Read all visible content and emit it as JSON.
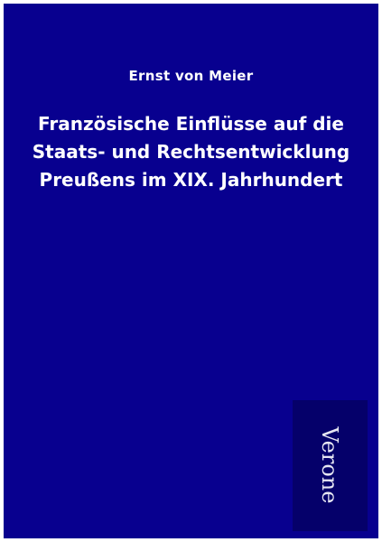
{
  "cover": {
    "author": "Ernst von Meier",
    "title_lines": [
      "Französische Einflüsse auf die",
      "Staats- und Rechtsentwicklung",
      "Preußens im XIX. Jahrhundert"
    ],
    "publisher": "Verone",
    "colors": {
      "background": "#08008f",
      "publisher_box": "#05006a",
      "text": "#ffffff"
    }
  }
}
